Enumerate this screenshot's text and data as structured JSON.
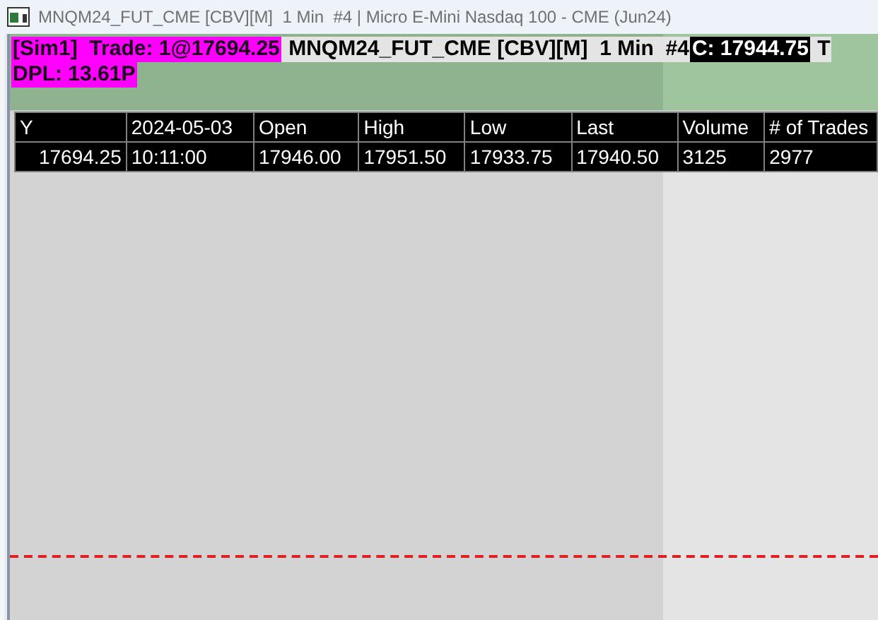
{
  "window": {
    "title": "MNQM24_FUT_CME [CBV][M]  1 Min  #4 | Micro E-Mini Nasdaq 100 - CME (Jun24)"
  },
  "header": {
    "segments": [
      {
        "kind": "alert",
        "text": "[Sim1]  Trade: 1@17694.25"
      },
      {
        "kind": "plain",
        "text": " MNQM24_FUT_CME [CBV][M]  1 Min  #4"
      },
      {
        "kind": "inverse",
        "text": "C: 17944.75"
      },
      {
        "kind": "plain",
        "text": " T"
      }
    ],
    "second_line": {
      "kind": "alert",
      "text": "DPL: 13.61P"
    }
  },
  "table": {
    "rows": [
      [
        "Y",
        "2024-05-03",
        "Open",
        "High",
        "Low",
        "Last",
        "Volume",
        "# of Trades"
      ],
      [
        "17694.25",
        "10:11:00",
        "17946.00",
        "17951.50",
        "17933.75",
        "17940.50",
        "3125",
        "2977"
      ]
    ]
  }
}
